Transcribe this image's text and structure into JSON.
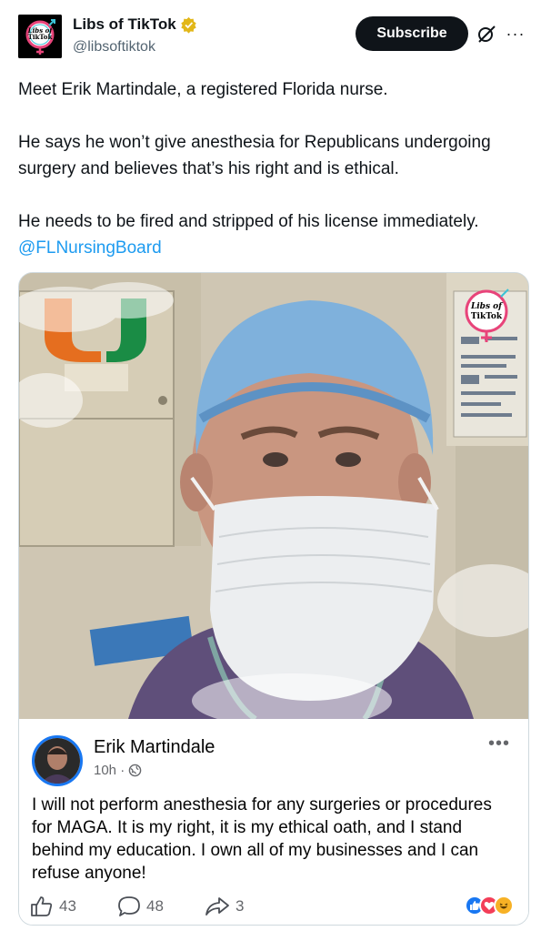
{
  "author": {
    "display_name": "Libs of TikTok",
    "handle": "@libsoftiktok",
    "avatar_logo_text": "Libs of TikTok",
    "verified_color": "#e2b719"
  },
  "actions": {
    "subscribe_label": "Subscribe"
  },
  "tweet": {
    "paragraphs": [
      "Meet Erik Martindale, a registered Florida nurse.",
      "He says he won’t give anesthesia for Republicans undergoing surgery and believes that’s his right and is ethical.",
      "He needs to be fired and stripped of his license immediately."
    ],
    "mention": "@FLNursingBoard",
    "mention_color": "#1d9bf0"
  },
  "media": {
    "watermark_text": "Libs of TikTok",
    "fb_post": {
      "name": "Erik Martindale",
      "time": "10h ·",
      "text": "I will not perform anesthesia for any surgeries or procedures for MAGA. It is my right, it is my ethical oath, and I stand behind my education. I own all of my businesses and I can refuse anyone!",
      "likes": "43",
      "comments": "48",
      "shares": "3"
    }
  },
  "icons": [
    "verified-badge-icon",
    "grok-icon",
    "more-icon",
    "globe-icon",
    "like-icon",
    "comment-icon",
    "share-icon",
    "reaction-like-icon",
    "reaction-love-icon",
    "reaction-haha-icon"
  ]
}
